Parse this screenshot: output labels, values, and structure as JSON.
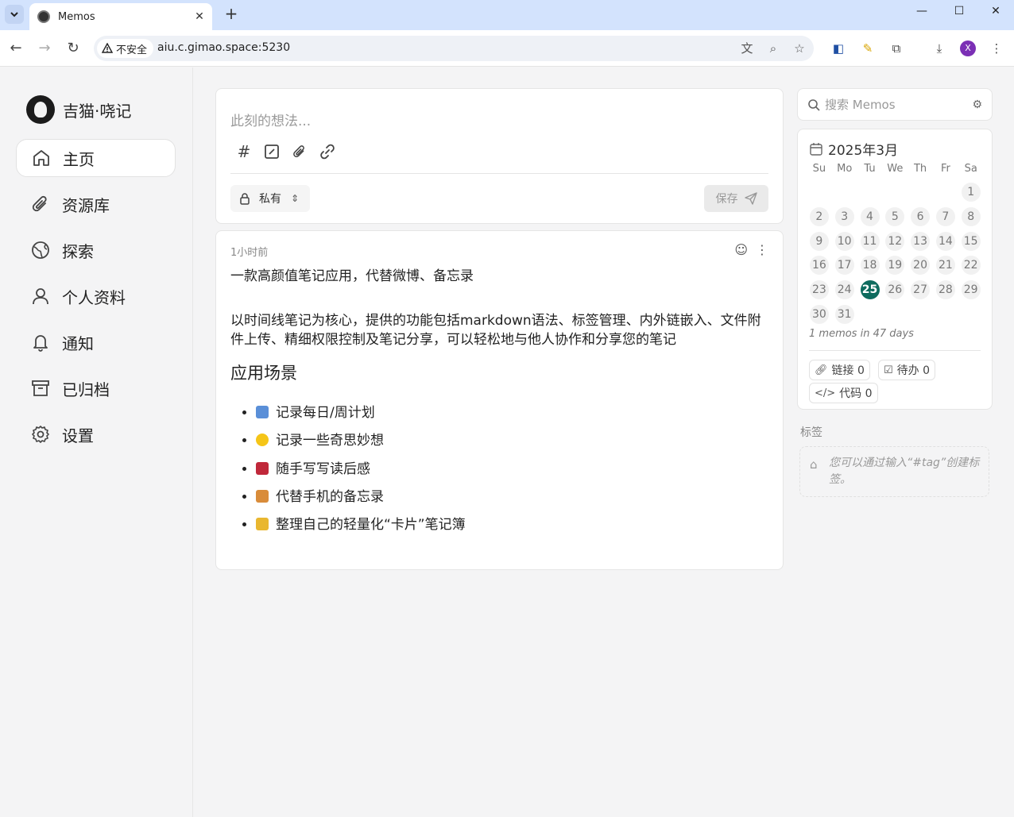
{
  "browser": {
    "tab_title": "Memos",
    "security_label": "不安全",
    "url": "aiu.c.gimao.space:5230",
    "profile_initial": "X"
  },
  "app": {
    "brand_name": "吉猫·哓记",
    "nav": [
      {
        "label": "主页",
        "icon": "home-icon",
        "active": true
      },
      {
        "label": "资源库",
        "icon": "paperclip-icon"
      },
      {
        "label": "探索",
        "icon": "globe-icon"
      },
      {
        "label": "个人资料",
        "icon": "user-icon"
      },
      {
        "label": "通知",
        "icon": "bell-icon"
      },
      {
        "label": "已归档",
        "icon": "archive-icon"
      },
      {
        "label": "设置",
        "icon": "gear-icon"
      }
    ]
  },
  "editor": {
    "placeholder": "此刻的想法...",
    "visibility": "私有",
    "save_label": "保存"
  },
  "memo": {
    "time": "1小时前",
    "line1": "一款高颜值笔记应用，代替微博、备忘录",
    "line2": "以时间线笔记为核心，提供的功能包括markdown语法、标签管理、内外链嵌入、文件附件上传、精细权限控制及笔记分享，可以轻松地与他人协作和分享您的笔记",
    "heading": "应用场景",
    "items": [
      {
        "text": "记录每日/周计划",
        "emoji_color": "#5a8fd8"
      },
      {
        "text": "记录一些奇思妙想",
        "emoji_color": "#f5c518"
      },
      {
        "text": "随手写写读后感",
        "emoji_color": "#c0283a"
      },
      {
        "text": "代替手机的备忘录",
        "emoji_color": "#d98c3a"
      },
      {
        "text": "整理自己的轻量化“卡片”笔记簿",
        "emoji_color": "#e9b730"
      }
    ]
  },
  "search": {
    "placeholder": "搜索 Memos"
  },
  "calendar": {
    "title": "2025年3月",
    "weekdays": [
      "Su",
      "Mo",
      "Tu",
      "We",
      "Th",
      "Fr",
      "Sa"
    ],
    "first_weekday": 6,
    "days_in_month": 31,
    "today": 25,
    "stat": "1 memos in 47 days"
  },
  "stats": {
    "links": "链接 0",
    "todo": "待办 0",
    "code": "代码 0"
  },
  "tags": {
    "title": "标签",
    "empty_hint": "您可以通过输入“#tag”创建标签。"
  }
}
